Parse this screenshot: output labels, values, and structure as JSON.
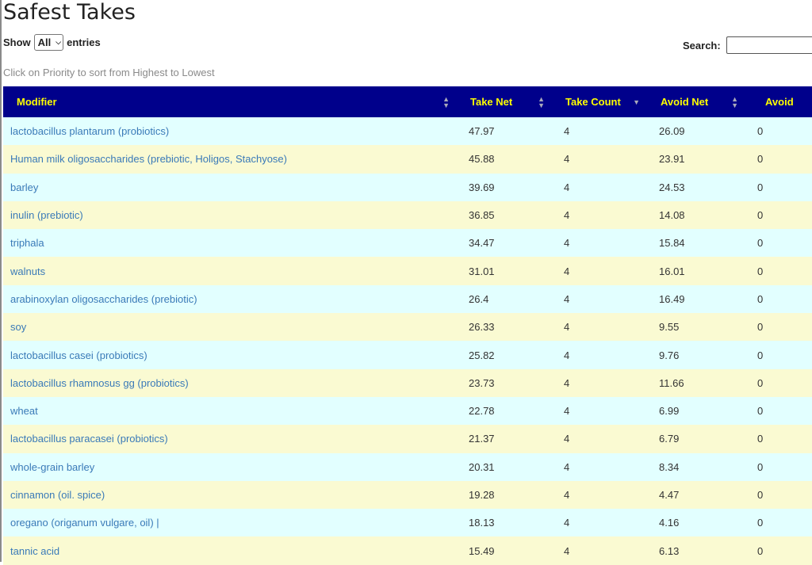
{
  "title": "Safest Takes",
  "length": {
    "show_label": "Show",
    "value": "All",
    "entries_label": "entries"
  },
  "search": {
    "label": "Search:",
    "value": ""
  },
  "hint": "Click on Priority to sort from Highest to Lowest",
  "columns": [
    "Modifier",
    "Take Net",
    "Take Count",
    "Avoid Net",
    "Avoid"
  ],
  "rows": [
    {
      "modifier": "lactobacillus plantarum (probiotics)",
      "take_net": "47.97",
      "take_count": "4",
      "avoid_net": "26.09",
      "avoid": "0"
    },
    {
      "modifier": "Human milk oligosaccharides (prebiotic, Holigos, Stachyose)",
      "take_net": "45.88",
      "take_count": "4",
      "avoid_net": "23.91",
      "avoid": "0"
    },
    {
      "modifier": "barley",
      "take_net": "39.69",
      "take_count": "4",
      "avoid_net": "24.53",
      "avoid": "0"
    },
    {
      "modifier": "inulin (prebiotic)",
      "take_net": "36.85",
      "take_count": "4",
      "avoid_net": "14.08",
      "avoid": "0"
    },
    {
      "modifier": "triphala",
      "take_net": "34.47",
      "take_count": "4",
      "avoid_net": "15.84",
      "avoid": "0"
    },
    {
      "modifier": "walnuts",
      "take_net": "31.01",
      "take_count": "4",
      "avoid_net": "16.01",
      "avoid": "0"
    },
    {
      "modifier": "arabinoxylan oligosaccharides (prebiotic)",
      "take_net": "26.4",
      "take_count": "4",
      "avoid_net": "16.49",
      "avoid": "0"
    },
    {
      "modifier": "soy",
      "take_net": "26.33",
      "take_count": "4",
      "avoid_net": "9.55",
      "avoid": "0"
    },
    {
      "modifier": "lactobacillus casei (probiotics)",
      "take_net": "25.82",
      "take_count": "4",
      "avoid_net": "9.76",
      "avoid": "0"
    },
    {
      "modifier": "lactobacillus rhamnosus gg (probiotics)",
      "take_net": "23.73",
      "take_count": "4",
      "avoid_net": "11.66",
      "avoid": "0"
    },
    {
      "modifier": "wheat",
      "take_net": "22.78",
      "take_count": "4",
      "avoid_net": "6.99",
      "avoid": "0"
    },
    {
      "modifier": "lactobacillus paracasei (probiotics)",
      "take_net": "21.37",
      "take_count": "4",
      "avoid_net": "6.79",
      "avoid": "0"
    },
    {
      "modifier": "whole-grain barley",
      "take_net": "20.31",
      "take_count": "4",
      "avoid_net": "8.34",
      "avoid": "0"
    },
    {
      "modifier": "cinnamon (oil. spice)",
      "take_net": "19.28",
      "take_count": "4",
      "avoid_net": "4.47",
      "avoid": "0"
    },
    {
      "modifier": "oregano (origanum vulgare, oil) |",
      "take_net": "18.13",
      "take_count": "4",
      "avoid_net": "4.16",
      "avoid": "0"
    },
    {
      "modifier": "tannic acid",
      "take_net": "15.49",
      "take_count": "4",
      "avoid_net": "6.13",
      "avoid": "0"
    }
  ]
}
